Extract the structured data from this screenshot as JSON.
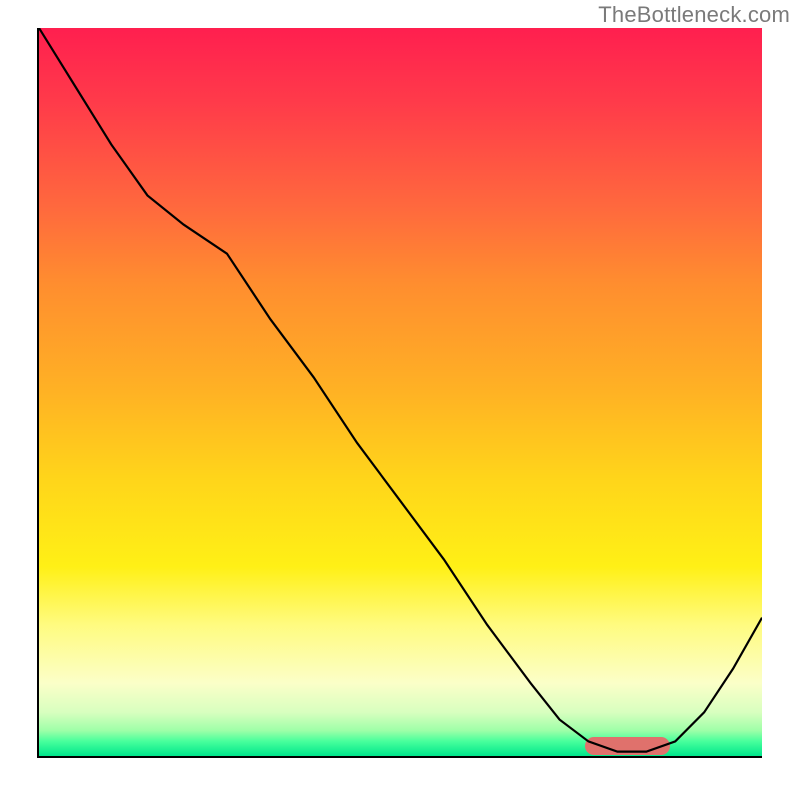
{
  "watermark": "TheBottleneck.com",
  "chart_data": {
    "type": "line",
    "x": [
      0.0,
      0.05,
      0.1,
      0.15,
      0.2,
      0.26,
      0.32,
      0.38,
      0.44,
      0.5,
      0.56,
      0.62,
      0.68,
      0.72,
      0.76,
      0.8,
      0.84,
      0.88,
      0.92,
      0.96,
      1.0
    ],
    "y": [
      1.0,
      0.92,
      0.84,
      0.77,
      0.73,
      0.69,
      0.6,
      0.52,
      0.43,
      0.35,
      0.27,
      0.18,
      0.1,
      0.05,
      0.02,
      0.006,
      0.006,
      0.02,
      0.06,
      0.12,
      0.19
    ],
    "flat_region_x": [
      0.78,
      0.9
    ],
    "flat_region_y": 0.006,
    "xlim": [
      0,
      1
    ],
    "ylim": [
      0,
      1
    ],
    "title": "",
    "xlabel": "",
    "ylabel": "",
    "gradient_stops": [
      {
        "pos": 0.0,
        "color": "#ff1f4f"
      },
      {
        "pos": 0.5,
        "color": "#ffb224"
      },
      {
        "pos": 0.85,
        "color": "#fffb80"
      },
      {
        "pos": 0.97,
        "color": "#47ff9c"
      },
      {
        "pos": 1.0,
        "color": "#00e68b"
      }
    ],
    "marker": {
      "x_start": 0.755,
      "x_end": 0.873,
      "y": 0.012,
      "color": "#e0716c"
    }
  }
}
